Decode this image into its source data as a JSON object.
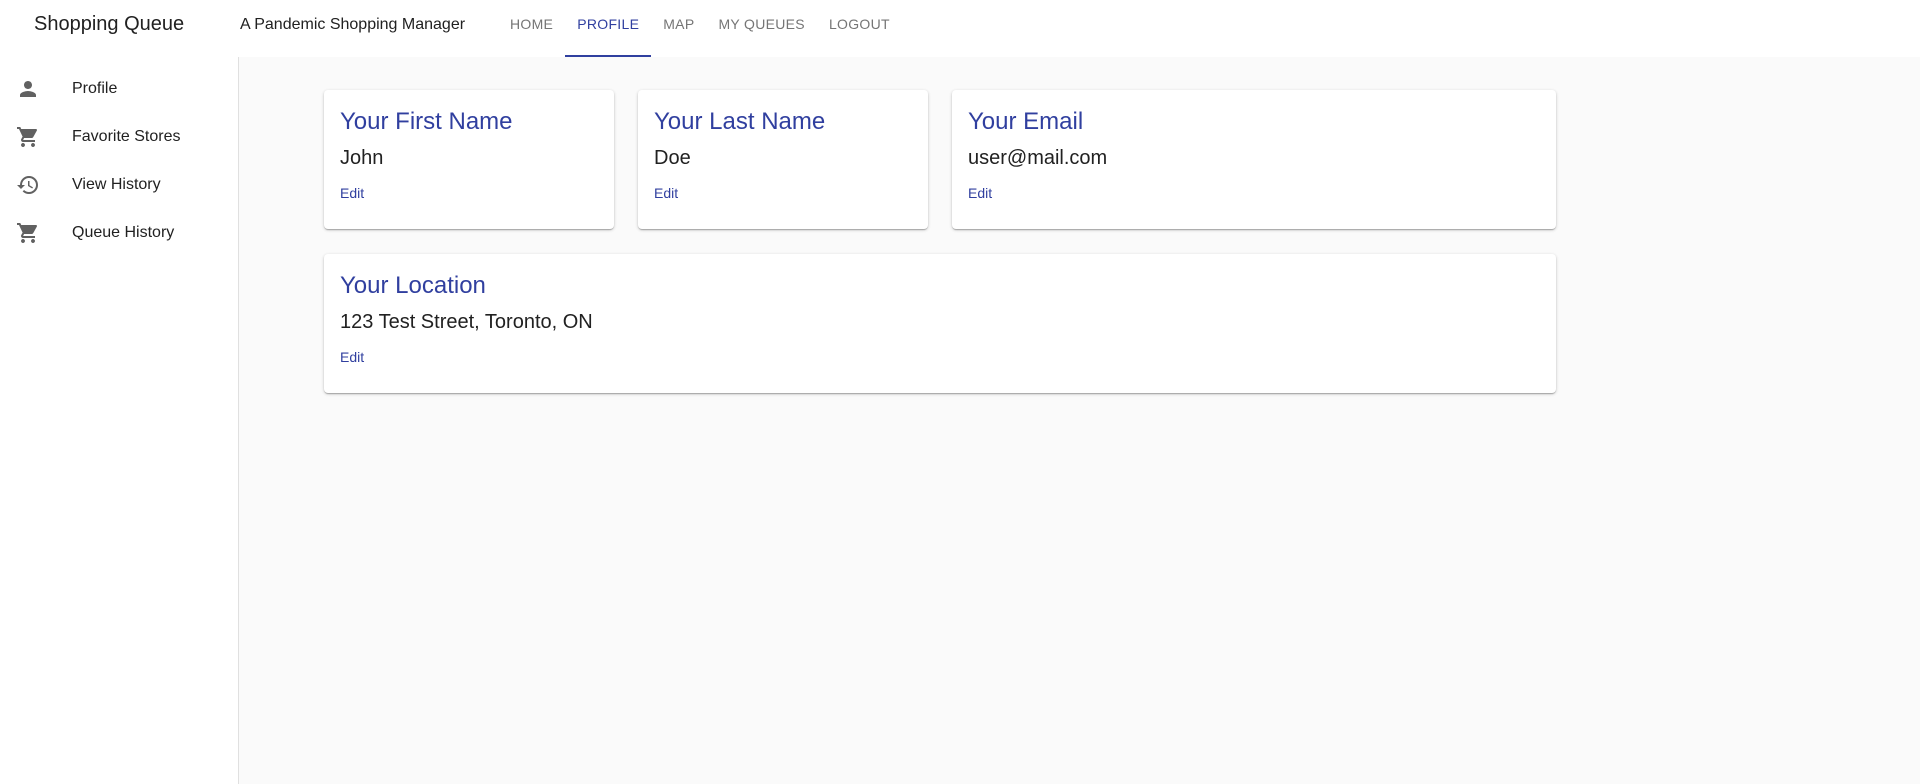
{
  "header": {
    "brand": "Shopping Queue",
    "tagline": "A Pandemic Shopping Manager",
    "tabs": [
      {
        "label": "HOME"
      },
      {
        "label": "PROFILE",
        "active": true
      },
      {
        "label": "MAP"
      },
      {
        "label": "MY QUEUES"
      },
      {
        "label": "LOGOUT"
      }
    ]
  },
  "sidebar": {
    "items": [
      {
        "label": "Profile",
        "icon": "person-icon"
      },
      {
        "label": "Favorite Stores",
        "icon": "cart-icon"
      },
      {
        "label": "View History",
        "icon": "history-icon"
      },
      {
        "label": "Queue History",
        "icon": "cart-icon"
      }
    ]
  },
  "cards": {
    "first_name": {
      "title": "Your First Name",
      "value": "John",
      "action": "Edit"
    },
    "last_name": {
      "title": "Your Last Name",
      "value": "Doe",
      "action": "Edit"
    },
    "email": {
      "title": "Your Email",
      "value": "user@mail.com",
      "action": "Edit"
    },
    "location": {
      "title": "Your Location",
      "value": "123 Test Street, Toronto, ON",
      "action": "Edit"
    }
  },
  "colors": {
    "primary": "#303f9f",
    "background": "#fafafa",
    "icon": "#616161"
  }
}
